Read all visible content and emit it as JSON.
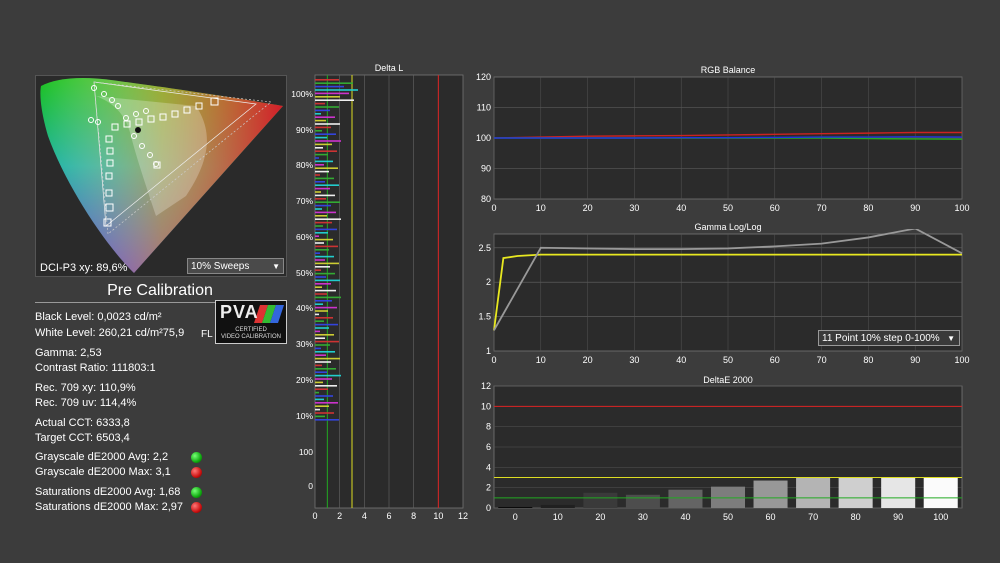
{
  "cie": {
    "coverage_label": "DCI-P3 xy: 89,6%",
    "sweeps_select": "10% Sweeps"
  },
  "pre_calibration": {
    "title": "Pre Calibration",
    "black_level": "Black Level: 0,0023 cd/m²",
    "white_level": "White Level: 260,21 cd/m²75,9",
    "white_level_unit": "FL",
    "gamma": "Gamma: 2,53",
    "contrast_ratio": "Contrast Ratio: 111803:1",
    "rec709_xy": "Rec. 709 xy: 110,9%",
    "rec709_uv": "Rec. 709 uv: 114,4%",
    "actual_cct": "Actual CCT: 6333,8",
    "target_cct": "Target CCT: 6503,4",
    "grayscale_avg": "Grayscale dE2000 Avg: 2,2",
    "grayscale_max": "Grayscale dE2000 Max: 3,1",
    "saturations_avg": "Saturations dE2000 Avg: 1,68",
    "saturations_max": "Saturations dE2000 Max: 2,97",
    "status_colors": {
      "good": "#22bb22",
      "bad": "#cc1111"
    }
  },
  "pva": {
    "logo": "PVA",
    "line1": "CERTIFIED",
    "line2": "VIDEO CALIBRATION"
  },
  "gamma_select": "11 Point 10% step 0-100%",
  "chart_data": [
    {
      "type": "bar",
      "title": "Delta L",
      "orientation": "horizontal",
      "y_tick_labels": [
        "100%",
        "90%",
        "80%",
        "70%",
        "60%",
        "50%",
        "40%",
        "30%",
        "20%",
        "10%",
        "100",
        "0"
      ],
      "x_ticks": [
        0,
        2,
        4,
        6,
        8,
        10,
        12
      ],
      "xlim": [
        0,
        12
      ],
      "threshold_lines": [
        {
          "value": 1,
          "color": "#22aa22"
        },
        {
          "value": 3,
          "color": "#dddd22"
        },
        {
          "value": 10,
          "color": "#dd2222"
        }
      ]
    },
    {
      "type": "line",
      "title": "RGB Balance",
      "x": [
        0,
        10,
        20,
        30,
        40,
        50,
        60,
        70,
        80,
        90,
        100
      ],
      "ylim": [
        80,
        120
      ],
      "y_ticks": [
        80,
        90,
        100,
        110,
        120
      ],
      "series": [
        {
          "color": "#cc2222",
          "values": [
            100,
            100.3,
            100.6,
            100.7,
            100.8,
            101,
            101.2,
            101.4,
            101.6,
            101.8,
            101.8
          ]
        },
        {
          "color": "#22aa22",
          "values": [
            100,
            100,
            100,
            100,
            100,
            100,
            100,
            100,
            99.8,
            99.7,
            99.6
          ]
        },
        {
          "color": "#2233dd",
          "values": [
            100,
            100,
            100,
            100,
            100.1,
            100.1,
            100.2,
            100.3,
            100.3,
            100.4,
            100.3
          ]
        }
      ]
    },
    {
      "type": "line",
      "title": "Gamma Log/Log",
      "x": [
        0,
        10,
        20,
        30,
        40,
        50,
        60,
        70,
        80,
        90,
        100
      ],
      "ylim": [
        1,
        2.7
      ],
      "y_ticks": [
        1,
        1.5,
        2,
        2.5
      ],
      "series": [
        {
          "color": "#e8e820",
          "x": [
            0,
            2,
            5,
            10,
            20,
            30,
            40,
            50,
            60,
            70,
            80,
            90,
            100
          ],
          "values": [
            1.3,
            2.35,
            2.38,
            2.4,
            2.4,
            2.4,
            2.4,
            2.4,
            2.4,
            2.4,
            2.4,
            2.4,
            2.4
          ]
        },
        {
          "color": "#999999",
          "x": [
            0,
            10,
            20,
            30,
            40,
            50,
            60,
            70,
            80,
            90,
            100
          ],
          "values": [
            1.3,
            2.5,
            2.49,
            2.48,
            2.48,
            2.49,
            2.52,
            2.56,
            2.65,
            2.78,
            2.42
          ]
        }
      ]
    },
    {
      "type": "bar",
      "title": "DeltaE 2000",
      "categories": [
        "0",
        "10",
        "20",
        "30",
        "40",
        "50",
        "60",
        "70",
        "80",
        "90",
        "100"
      ],
      "values": [
        0.1,
        0.3,
        1.5,
        1.3,
        1.8,
        2.1,
        2.7,
        3.0,
        3.0,
        3.0,
        3.0
      ],
      "bar_colors": [
        "#0a0a0a",
        "#202020",
        "#3a3a3a",
        "#4d4d4d",
        "#646464",
        "#7d7d7d",
        "#989898",
        "#b4b4b4",
        "#cfcfcf",
        "#e6e6e6",
        "#fbfbfb"
      ],
      "ylim": [
        0,
        12
      ],
      "y_ticks": [
        0,
        2,
        4,
        6,
        8,
        10,
        12
      ],
      "threshold_lines": [
        {
          "value": 1,
          "color": "#22aa22"
        },
        {
          "value": 3,
          "color": "#dddd22"
        },
        {
          "value": 10,
          "color": "#dd2222"
        }
      ]
    }
  ]
}
